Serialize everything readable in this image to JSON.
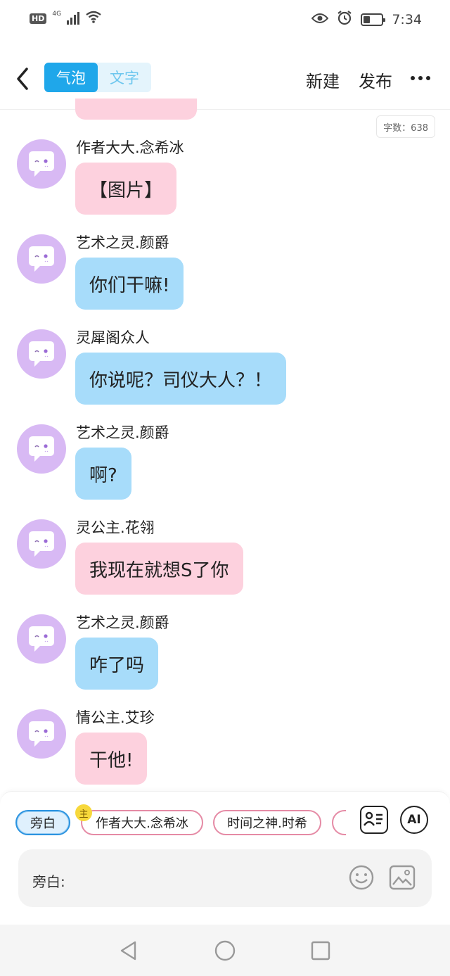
{
  "status_bar": {
    "hd": "HD",
    "network": "4G",
    "time": "7:34"
  },
  "header": {
    "segments": [
      {
        "label": "气泡",
        "active": true
      },
      {
        "label": "文字",
        "active": false
      }
    ],
    "new_label": "新建",
    "publish_label": "发布",
    "icons": {
      "back": "chevron-left-icon",
      "more": "more-dots-icon"
    }
  },
  "word_count": "字数：638",
  "messages": [
    {
      "name": "作者大大.念希冰",
      "text": "【图片】",
      "color": "pink"
    },
    {
      "name": "艺术之灵.颜爵",
      "text": "你们干嘛!",
      "color": "blue"
    },
    {
      "name": "灵犀阁众人",
      "text": "你说呢？司仪大人？！",
      "color": "blue"
    },
    {
      "name": "艺术之灵.颜爵",
      "text": "啊?",
      "color": "blue"
    },
    {
      "name": "灵公主.花翎",
      "text": "我现在就想S了你",
      "color": "pink"
    },
    {
      "name": "艺术之灵.颜爵",
      "text": "咋了吗",
      "color": "blue"
    },
    {
      "name": "情公主.艾珍",
      "text": "干他!",
      "color": "pink"
    }
  ],
  "character_chips": [
    {
      "label": "旁白",
      "selected": true
    },
    {
      "label": "作者大大.念希冰",
      "badge": "主"
    },
    {
      "label": "时间之神.时希"
    }
  ],
  "ai_label": "AI",
  "input": {
    "label": "旁白:"
  },
  "colors": {
    "accent": "#1fa7ea",
    "pink_bubble": "#fdd1de",
    "blue_bubble": "#a7dcfa",
    "avatar": "#d8b9f4"
  }
}
